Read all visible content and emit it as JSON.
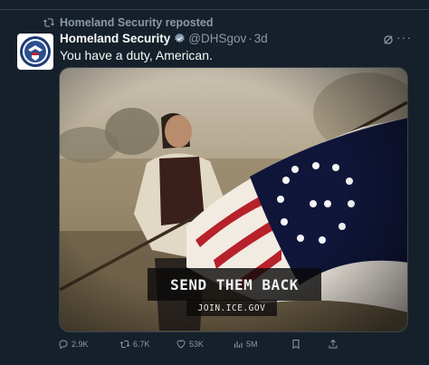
{
  "repost": {
    "label": "Homeland Security reposted",
    "icon": "repost-icon"
  },
  "tweet": {
    "author_name": "Homeland Security",
    "handle": "@DHSgov",
    "separator": "·",
    "time": "3d",
    "text": "You have a duty, American.",
    "more": "···"
  },
  "media": {
    "caption": "SEND THEM BACK",
    "subcaption": "JOIN.ICE.GOV"
  },
  "actions": {
    "replies": "2.9K",
    "reposts": "6.7K",
    "likes": "53K",
    "views": "5M"
  },
  "colors": {
    "background": "#15202b",
    "muted": "#8b98a5",
    "verified": "#829aab"
  }
}
